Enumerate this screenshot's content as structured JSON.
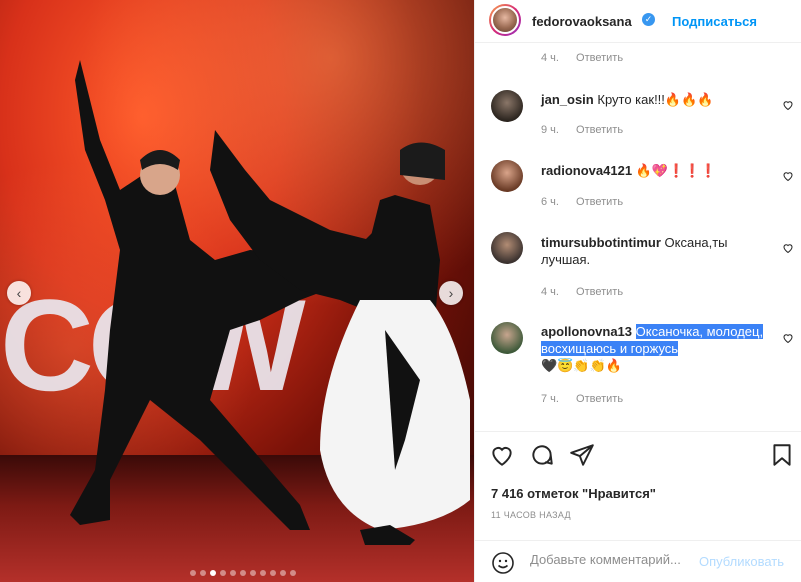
{
  "post": {
    "username": "fedorovaoksana",
    "subscribe_label": "Подписаться",
    "likes_text": "7 416 отметок \"Нравится\"",
    "time_ago": "11 ЧАСОВ НАЗАД"
  },
  "photo": {
    "big_letters": "COW",
    "carousel_count": 11,
    "carousel_active_index": 2
  },
  "comments": [
    {
      "meta": "4 ч.",
      "reply_label": "Ответить"
    },
    {
      "username": "jan_osin",
      "text": "Круто как!!!🔥🔥🔥",
      "meta": "9 ч.",
      "reply_label": "Ответить"
    },
    {
      "username": "radionova4121",
      "text": "🔥💖❗❗❗",
      "meta": "6 ч.",
      "reply_label": "Ответить"
    },
    {
      "username": "timursubbotintimur",
      "text": "Оксана,ты лучшая.",
      "meta": "4 ч.",
      "reply_label": "Ответить"
    },
    {
      "username": "apollonovna13",
      "text": "Оксаночка, молодец, восхищаюсь и горжусь",
      "text_tail": "🖤😇👏👏🔥",
      "meta": "7 ч.",
      "reply_label": "Ответить"
    }
  ],
  "add_comment": {
    "placeholder": "Добавьте комментарий...",
    "publish_label": "Опубликовать"
  },
  "colors": {
    "accent": "#0095f6",
    "muted": "#8e8e8e",
    "highlight": "#3b82f6"
  }
}
